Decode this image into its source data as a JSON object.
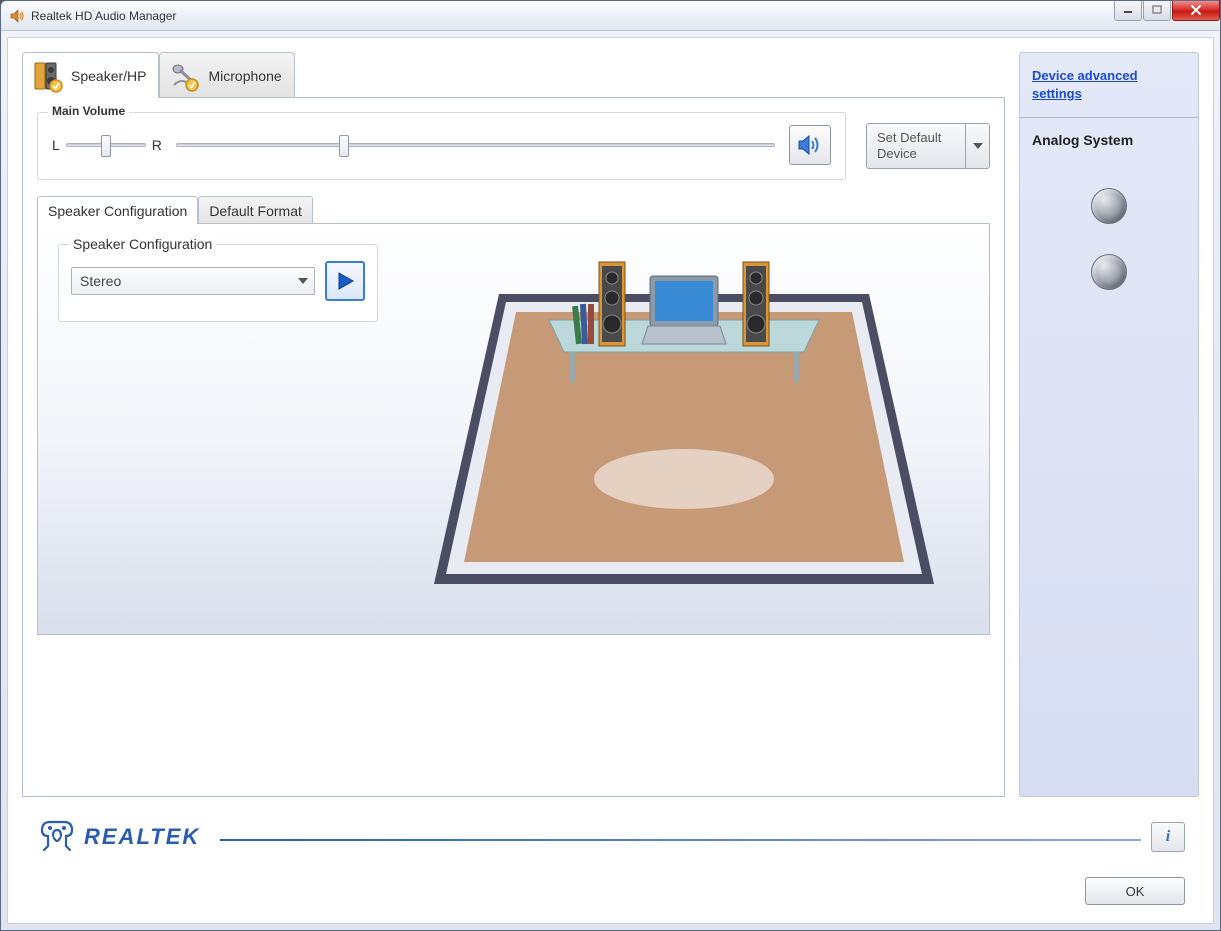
{
  "window": {
    "title": "Realtek HD Audio Manager"
  },
  "tabs": {
    "speaker": "Speaker/HP",
    "microphone": "Microphone"
  },
  "volume": {
    "legend": "Main Volume",
    "left_label": "L",
    "right_label": "R",
    "balance_pct": 50,
    "main_pct": 28
  },
  "default_device": {
    "label": "Set Default Device"
  },
  "sub_tabs": {
    "speaker_config": "Speaker Configuration",
    "default_format": "Default Format"
  },
  "config": {
    "legend": "Speaker Configuration",
    "selected": "Stereo"
  },
  "sidebar": {
    "advanced_link": "Device advanced settings",
    "system_title": "Analog System"
  },
  "brand": {
    "name": "REALTEK"
  },
  "info_button": "i",
  "ok_button": "OK"
}
